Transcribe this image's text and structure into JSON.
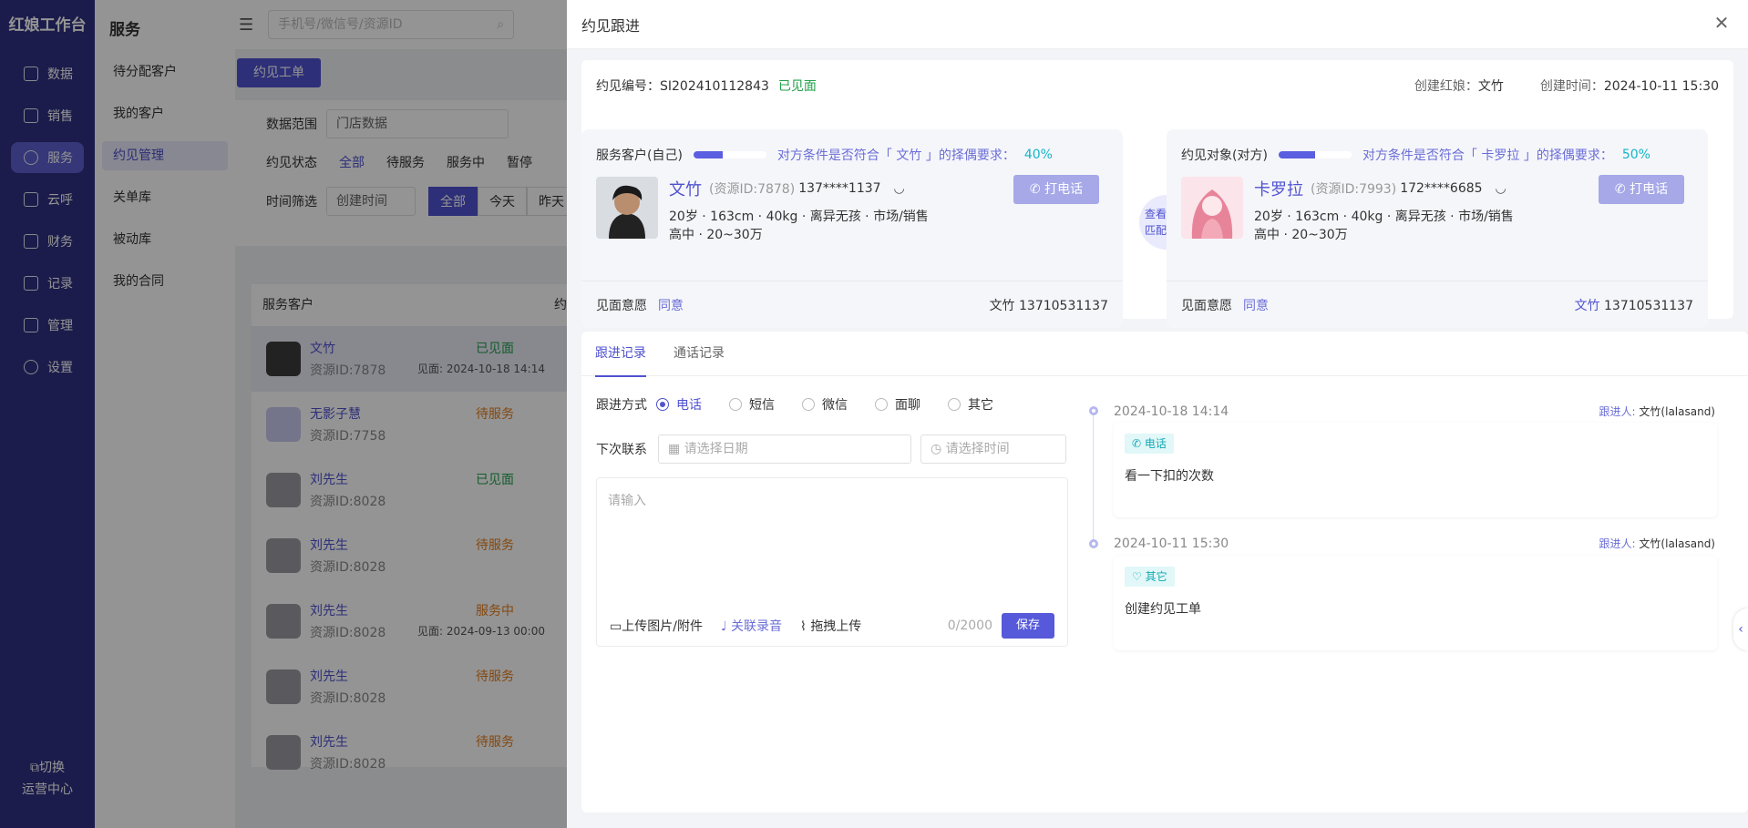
{
  "nav": {
    "brand": "红娘工作台",
    "items": [
      {
        "label": "数据",
        "icon": "chart-icon"
      },
      {
        "label": "销售",
        "icon": "cart-icon"
      },
      {
        "label": "服务",
        "icon": "heart-icon"
      },
      {
        "label": "云呼",
        "icon": "phone-icon"
      },
      {
        "label": "财务",
        "icon": "finance-icon"
      },
      {
        "label": "记录",
        "icon": "document-icon"
      },
      {
        "label": "管理",
        "icon": "manage-icon"
      },
      {
        "label": "设置",
        "icon": "gear-icon"
      }
    ],
    "switch_label": "切换",
    "switch_sub": "运营中心"
  },
  "subnav": {
    "title": "服务",
    "items": [
      "待分配客户",
      "我的客户",
      "约见管理",
      "关单库",
      "被动库",
      "我的合同"
    ]
  },
  "topbar": {
    "search_placeholder": "手机号/微信号/资源ID"
  },
  "bg": {
    "create_btn": "约见工单",
    "range_label": "数据范围",
    "range_value": "门店数据",
    "status_label": "约见状态",
    "status_tabs": [
      "全部",
      "待服务",
      "服务中",
      "暂停"
    ],
    "time_label": "时间筛选",
    "time_select": "创建时间",
    "time_btns": [
      "全部",
      "今天",
      "昨天"
    ],
    "col_customer": "服务客户",
    "col_other": "约",
    "customers": [
      {
        "name": "文竹",
        "id": "资源ID:7878",
        "status": "已见面",
        "sub": "见面: 2024-10-18 14:14",
        "cls": "green"
      },
      {
        "name": "无影子慧",
        "id": "资源ID:7758",
        "status": "待服务",
        "sub": "",
        "cls": "orange"
      },
      {
        "name": "刘先生",
        "id": "资源ID:8028",
        "status": "已见面",
        "sub": "",
        "cls": "green"
      },
      {
        "name": "刘先生",
        "id": "资源ID:8028",
        "status": "待服务",
        "sub": "",
        "cls": "orange"
      },
      {
        "name": "刘先生",
        "id": "资源ID:8028",
        "status": "服务中",
        "sub": "见面: 2024-09-13 00:00",
        "cls": "orange"
      },
      {
        "name": "刘先生",
        "id": "资源ID:8028",
        "status": "待服务",
        "sub": "",
        "cls": "orange"
      },
      {
        "name": "刘先生",
        "id": "资源ID:8028",
        "status": "待服务",
        "sub": "",
        "cls": "orange"
      }
    ]
  },
  "drawer": {
    "title": "约见跟进",
    "meet_no_label": "约见编号：",
    "meet_no": "SI202410112843",
    "meet_status": "已见面",
    "creator_label": "创建红娘：",
    "creator": "文竹",
    "created_label": "创建时间：",
    "created": "2024-10-11 15:30",
    "self": {
      "head": "服务客户(自己)",
      "progress": 0.4,
      "req_pre": "对方条件是否符合「 文竹 」的择偶要求：",
      "pct": "40%",
      "name": "文竹",
      "rid": "(资源ID:7878)",
      "phone": "137****1137",
      "info1": "20岁 ·  163cm · 40kg · 离异无孩 · 市场/销售",
      "info2": "高中 · 20~30万",
      "call": "打电话",
      "will_label": "见面意愿",
      "will": "同意",
      "contact": "文竹 13710531137"
    },
    "other": {
      "head": "约见对象(对方)",
      "progress": 0.5,
      "req_pre": "对方条件是否符合「 卡罗拉 」的择偶要求：",
      "pct": "50%",
      "name": "卡罗拉",
      "rid": "(资源ID:7993)",
      "phone": "172****6685",
      "info1": "20岁 ·  163cm · 40kg · 离异无孩 · 市场/销售",
      "info2": "高中 · 20~30万",
      "call": "打电话",
      "will_label": "见面意愿",
      "will": "同意",
      "contact_name": "文竹",
      "contact_phone": "13710531137"
    },
    "match": [
      "查看双方",
      "匹配情况"
    ],
    "tabs": [
      "跟进记录",
      "通话记录"
    ],
    "method_label": "跟进方式",
    "methods": [
      "电话",
      "短信",
      "微信",
      "面聊",
      "其它"
    ],
    "next_label": "下次联系",
    "date_placeholder": "请选择日期",
    "time_placeholder": "请选择时间",
    "textarea_placeholder": "请输入",
    "upload": "上传图片/附件",
    "record": "关联录音",
    "drag": "拖拽上传",
    "count": "0/2000",
    "save": "保存",
    "timeline": [
      {
        "time": "2024-10-18 14:14",
        "follower_label": "跟进人:",
        "follower": "文竹(lalasand)",
        "tag": "电话",
        "note": "看一下扣的次数"
      },
      {
        "time": "2024-10-11 15:30",
        "follower_label": "跟进人:",
        "follower": "文竹(lalasand)",
        "tag": "其它",
        "note": "创建约见工单"
      }
    ]
  },
  "colors": {
    "primary": "#4f52cf",
    "nav_bg": "#2f3181",
    "green": "#22a14a",
    "orange": "#e37d1b",
    "teal": "#14b5c7"
  }
}
